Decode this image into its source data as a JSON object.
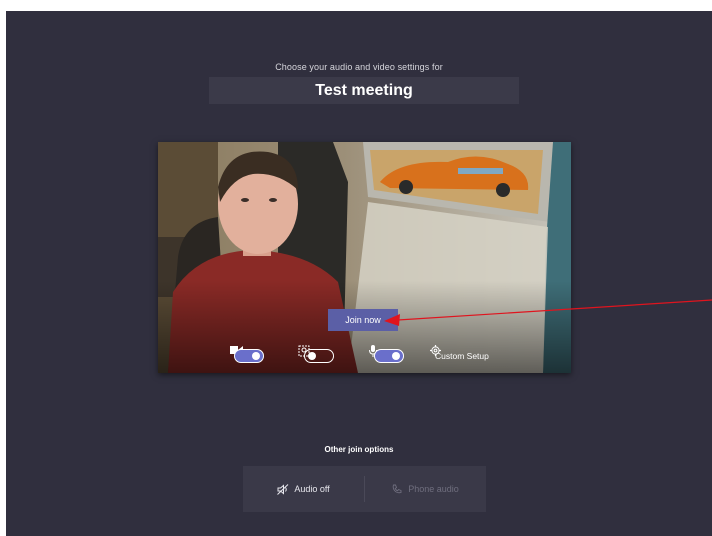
{
  "prejoin": {
    "subtitle": "Choose your audio and video settings for",
    "meeting_title": "Test meeting"
  },
  "video_preview": {
    "join_button_label": "Join now",
    "controls": {
      "camera_toggle": "on",
      "background_blur_toggle": "off",
      "mic_toggle": "on",
      "custom_setup_label": "Custom Setup"
    }
  },
  "other_join_options": {
    "title": "Other join options",
    "audio_off_label": "Audio off",
    "phone_audio_label": "Phone audio"
  },
  "annotation": {
    "arrow_color": "#e0141e"
  },
  "colors": {
    "background": "#302f3e",
    "accent": "#6a6fcb",
    "join_button": "#5b5fa6"
  }
}
